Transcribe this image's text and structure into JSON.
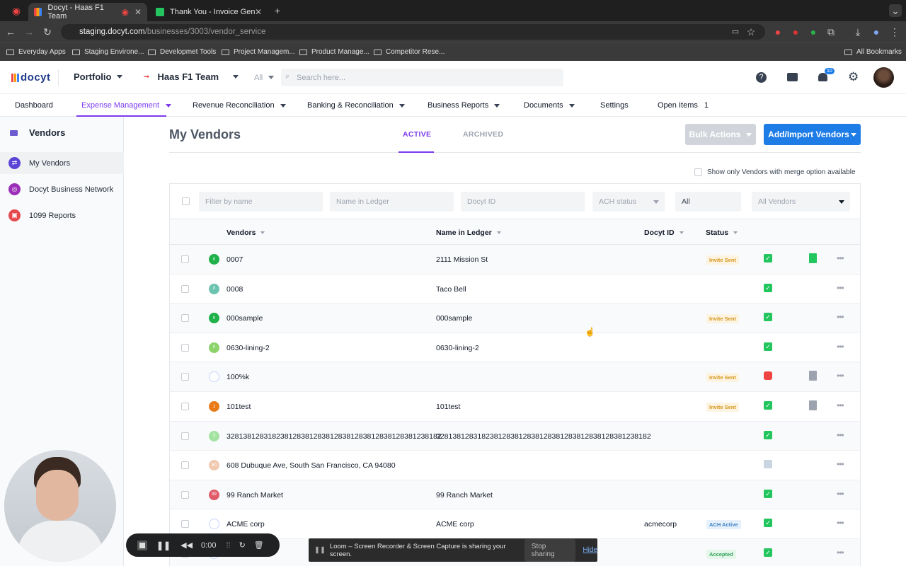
{
  "browser": {
    "tabs": [
      {
        "title": "Docyt - Haas F1 Team"
      },
      {
        "title": "Thank You - Invoice Generat"
      }
    ],
    "url_host": "staging.docyt.com",
    "url_path": "/businesses/3003/vendor_service",
    "bookmarks": [
      "Everyday Apps",
      "Staging Environe...",
      "Developmet Tools",
      "Project Managem...",
      "Product Manage...",
      "Competitor Rese..."
    ],
    "all_bookmarks": "All Bookmarks"
  },
  "header": {
    "logo": "docyt",
    "portfolio": "Portfolio",
    "business": "Haas F1 Team",
    "search_scope": "All",
    "search_placeholder": "Search here...",
    "notification_count": "10"
  },
  "nav": {
    "items": [
      "Dashboard",
      "Expense Management",
      "Revenue Reconciliation",
      "Banking & Reconciliation",
      "Business Reports",
      "Documents",
      "Settings",
      "Open Items"
    ],
    "open_items_count": "1"
  },
  "sidebar": {
    "title": "Vendors",
    "items": [
      "My Vendors",
      "Docyt Business Network",
      "1099 Reports"
    ]
  },
  "page": {
    "title": "My Vendors",
    "tabs": [
      "ACTIVE",
      "ARCHIVED"
    ],
    "bulk_actions": "Bulk Actions",
    "add_vendors": "Add/Import Vendors",
    "merge_label": "Show only Vendors with merge option available"
  },
  "filters": {
    "name_placeholder": "Filter by name",
    "ledger_placeholder": "Name in Ledger",
    "docyt_id_placeholder": "Docyt ID",
    "ach_placeholder": "ACH status",
    "all_value": "All",
    "vendors_select": "All Vendors"
  },
  "columns": [
    "Vendors",
    "Name in Ledger",
    "Docyt ID",
    "Status"
  ],
  "rows": [
    {
      "name": "0007",
      "ledger": "2111 Mission St",
      "docyt_id": "",
      "badge": "Invite Sent",
      "avatar_color": "#1fb14a",
      "avatar_text": "0",
      "status_icon": "green",
      "doc": "green"
    },
    {
      "name": "0008",
      "ledger": "Taco Bell",
      "docyt_id": "",
      "badge": "",
      "avatar_color": "#6cc3b0",
      "avatar_text": "0",
      "status_icon": "green",
      "doc": ""
    },
    {
      "name": "000sample",
      "ledger": "000sample",
      "docyt_id": "",
      "badge": "Invite Sent",
      "avatar_color": "#1fb14a",
      "avatar_text": "0",
      "status_icon": "green",
      "doc": ""
    },
    {
      "name": "0630-lining-2",
      "ledger": "0630-lining-2",
      "docyt_id": "",
      "badge": "",
      "avatar_color": "#8bd36a",
      "avatar_text": "0",
      "status_icon": "green",
      "doc": ""
    },
    {
      "name": "100%k",
      "ledger": "",
      "docyt_id": "",
      "badge": "Invite Sent",
      "avatar_color": "#ffffff",
      "avatar_text": "",
      "status_icon": "red",
      "doc": "grey"
    },
    {
      "name": "101test",
      "ledger": "101test",
      "docyt_id": "",
      "badge": "Invite Sent",
      "avatar_color": "#e87a1a",
      "avatar_text": "1",
      "status_icon": "green",
      "doc": "grey"
    },
    {
      "name": "3281381283182381283812838128381283812838128381238182",
      "ledger": "3281381283182381283812838128381283812838128381238182",
      "docyt_id": "",
      "badge": "",
      "avatar_color": "#a3e2a0",
      "avatar_text": "3",
      "status_icon": "green",
      "doc": ""
    },
    {
      "name": "608 Dubuque Ave, South San Francisco, CA 94080",
      "ledger": "",
      "docyt_id": "",
      "badge": "",
      "avatar_color": "#f1c9b0",
      "avatar_text": "60",
      "status_icon": "grey",
      "doc": ""
    },
    {
      "name": "99 Ranch Market",
      "ledger": "99 Ranch Market",
      "docyt_id": "",
      "badge": "",
      "avatar_color": "#e05a6a",
      "avatar_text": "99",
      "status_icon": "green",
      "doc": ""
    },
    {
      "name": "ACME corp",
      "ledger": "ACME corp",
      "docyt_id": "acmecorp",
      "badge": "ACH Active",
      "avatar_color": "#ffffff",
      "avatar_text": "",
      "status_icon": "green",
      "doc": ""
    },
    {
      "name": "",
      "ledger": "",
      "docyt_id": "",
      "badge": "Accepted",
      "avatar_color": "#ffffff",
      "avatar_text": "",
      "status_icon": "green",
      "doc": ""
    }
  ],
  "loom": {
    "timer": "0:00",
    "share_message": "Loom – Screen Recorder & Screen Capture is sharing your screen.",
    "stop_sharing": "Stop sharing",
    "hide": "Hide"
  }
}
